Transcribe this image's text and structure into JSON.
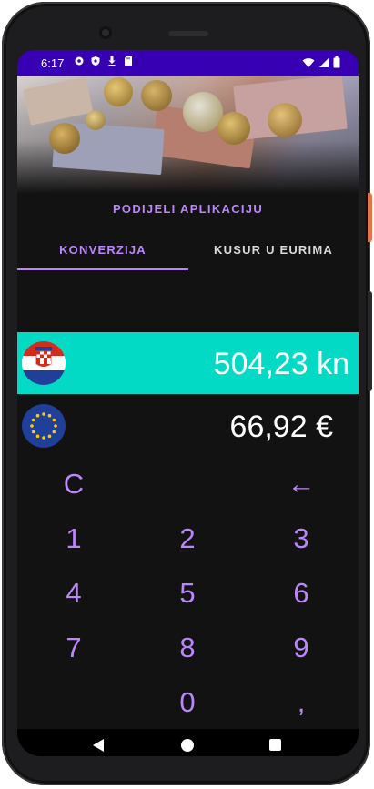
{
  "status_bar": {
    "time": "6:17",
    "left_icons": [
      "gear-icon",
      "shield-icon",
      "download-icon",
      "sd-card-icon"
    ],
    "right_icons": [
      "wifi-icon",
      "signal-icon",
      "battery-icon"
    ],
    "background": "#3700b3"
  },
  "header": {
    "share_label": "PODIJELI APLIKACIJU"
  },
  "tabs": [
    {
      "label": "KONVERZIJA",
      "active": true
    },
    {
      "label": "KUSUR U EURIMA",
      "active": false
    }
  ],
  "converter": {
    "hrk": {
      "amount": "504,23 kn",
      "flag": "croatia-flag-icon",
      "highlight": "#03dac5"
    },
    "eur": {
      "amount": "66,92 €",
      "flag": "eu-flag-icon"
    }
  },
  "keypad": {
    "clear": "C",
    "backspace": "←",
    "digits": [
      "1",
      "2",
      "3",
      "4",
      "5",
      "6",
      "7",
      "8",
      "9",
      "0"
    ],
    "comma": ","
  },
  "nav_bar": [
    "back-icon",
    "home-icon",
    "recents-icon"
  ],
  "colors": {
    "accent": "#bb86fc",
    "teal": "#03dac5",
    "background": "#121212"
  }
}
